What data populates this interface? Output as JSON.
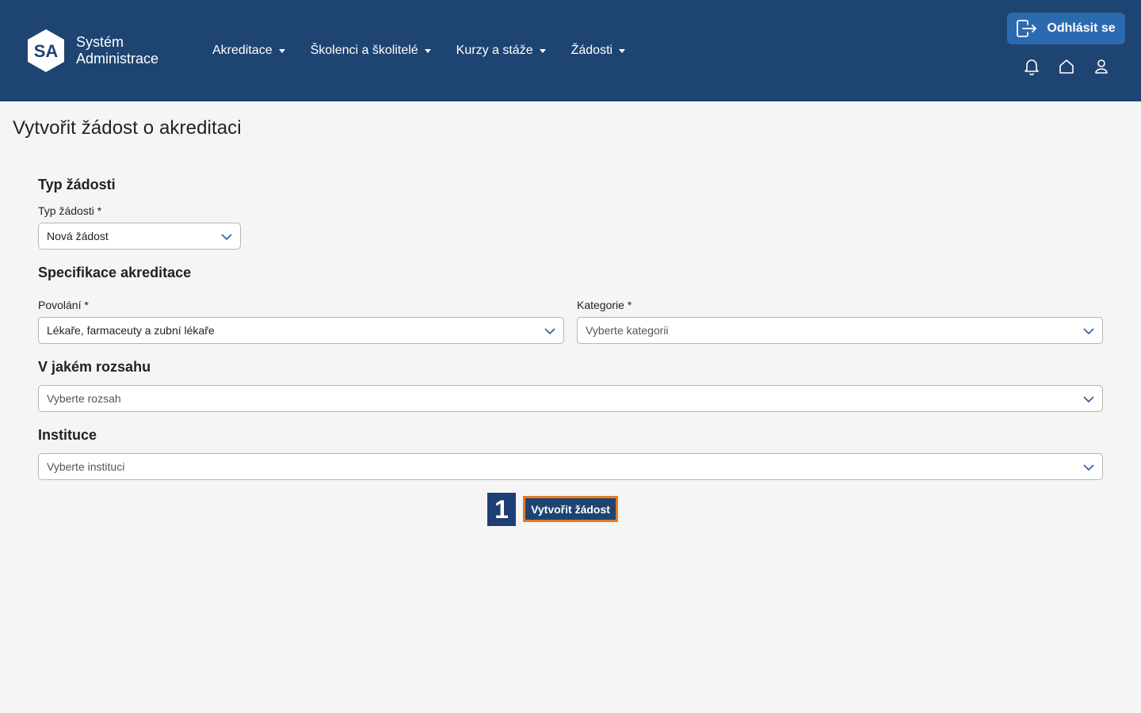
{
  "header": {
    "logo": {
      "initials": "SA",
      "line1": "Systém",
      "line2": "Administrace"
    },
    "nav": [
      {
        "label": "Akreditace"
      },
      {
        "label": "Školenci a školitelé"
      },
      {
        "label": "Kurzy a stáže"
      },
      {
        "label": "Žádosti"
      }
    ],
    "logout_label": "Odhlásit se",
    "icons": [
      "bell-icon",
      "home-icon",
      "user-icon"
    ],
    "colors": {
      "header_bg": "#1e4471",
      "logout_bg": "#2c6ab0",
      "highlight": "#e07b24"
    }
  },
  "page": {
    "title": "Vytvořit žádost o akreditaci"
  },
  "form": {
    "section_type": {
      "heading": "Typ žádosti",
      "label": "Typ žádosti *",
      "value": "Nová žádost"
    },
    "section_spec": {
      "heading": "Specifikace akreditace",
      "povolani_label": "Povolání *",
      "povolani_value": "Lékaře, farmaceuty a zubní lékaře",
      "kategorie_label": "Kategorie *",
      "kategorie_placeholder": "Vyberte kategorii"
    },
    "section_scope": {
      "heading": "V jakém rozsahu",
      "placeholder": "Vyberte rozsah"
    },
    "section_inst": {
      "heading": "Instituce",
      "placeholder": "Vyberte instituci"
    },
    "step_number": "1",
    "submit_label": "Vytvořit žádost"
  }
}
